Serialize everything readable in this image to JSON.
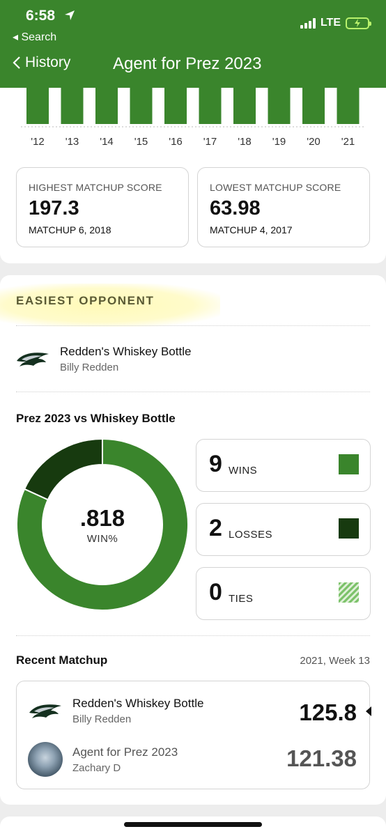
{
  "status_bar": {
    "time": "6:58",
    "back_app": "Search",
    "network": "LTE"
  },
  "nav": {
    "back_label": "History",
    "title": "Agent for Prez 2023"
  },
  "season_chart": {
    "years": [
      "'12",
      "'13",
      "'14",
      "'15",
      "'16",
      "'17",
      "'18",
      "'19",
      "'20",
      "'21"
    ],
    "bar_color": "#3a852c"
  },
  "highest": {
    "label": "HIGHEST MATCHUP SCORE",
    "value": "197.3",
    "sub": "MATCHUP 6, 2018"
  },
  "lowest": {
    "label": "LOWEST MATCHUP SCORE",
    "value": "63.98",
    "sub": "MATCHUP 4, 2017"
  },
  "easiest": {
    "section_title": "EASIEST OPPONENT",
    "team_name": "Redden's Whiskey Bottle",
    "owner": "Billy Redden",
    "team_icon": "eagle-logo"
  },
  "versus": {
    "title": "Prez 2023 vs Whiskey Bottle",
    "win_pct": ".818",
    "win_pct_label": "WIN%",
    "wins": {
      "count": "9",
      "label": "WINS",
      "color": "#3a852c"
    },
    "losses": {
      "count": "2",
      "label": "LOSSES",
      "color": "#173a0f"
    },
    "ties": {
      "count": "0",
      "label": "TIES",
      "color": "#7cc26a"
    }
  },
  "recent": {
    "title": "Recent Matchup",
    "week": "2021, Week 13",
    "team1": {
      "name": "Redden's Whiskey Bottle",
      "owner": "Billy Redden",
      "score": "125.8"
    },
    "team2": {
      "name": "Agent for Prez 2023",
      "owner": "Zachary D",
      "score": "121.38"
    }
  }
}
